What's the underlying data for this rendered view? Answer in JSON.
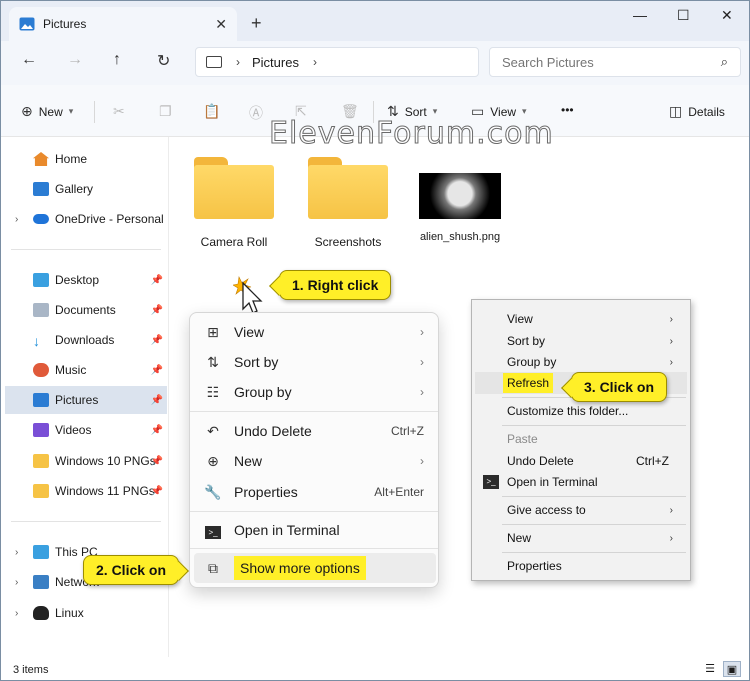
{
  "window": {
    "tab_title": "Pictures",
    "tab_close": "✕",
    "new_tab": "+",
    "minimize": "—",
    "maximize": "☐",
    "close": "✕"
  },
  "address": {
    "crumb": "Pictures",
    "search_placeholder": "Search Pictures"
  },
  "toolbar": {
    "new_label": "New",
    "sort_label": "Sort",
    "view_label": "View",
    "more_label": "•••",
    "details_label": "Details"
  },
  "watermark": "ElevenForum.com",
  "sidebar": {
    "items": [
      {
        "label": "Home"
      },
      {
        "label": "Gallery"
      },
      {
        "label": "OneDrive - Personal"
      },
      {
        "label": "Desktop"
      },
      {
        "label": "Documents"
      },
      {
        "label": "Downloads"
      },
      {
        "label": "Music"
      },
      {
        "label": "Pictures"
      },
      {
        "label": "Videos"
      },
      {
        "label": "Windows 10 PNGs"
      },
      {
        "label": "Windows 11 PNGs"
      },
      {
        "label": "This PC"
      },
      {
        "label": "Network"
      },
      {
        "label": "Linux"
      }
    ]
  },
  "files": [
    {
      "name": "Camera Roll",
      "type": "folder"
    },
    {
      "name": "Screenshots",
      "type": "folder"
    },
    {
      "name": "alien_shush.png",
      "type": "image"
    }
  ],
  "status": {
    "count": "3 items"
  },
  "callouts": {
    "right_click": "1. Right click",
    "click_on_2": "2. Click on",
    "click_on_3": "3. Click on"
  },
  "context_menu": {
    "view": "View",
    "sort_by": "Sort by",
    "group_by": "Group by",
    "undo_delete": "Undo Delete",
    "undo_shortcut": "Ctrl+Z",
    "new": "New",
    "properties": "Properties",
    "properties_shortcut": "Alt+Enter",
    "open_terminal": "Open in Terminal",
    "show_more": "Show more options"
  },
  "classic_menu": {
    "view": "View",
    "sort_by": "Sort by",
    "group_by": "Group by",
    "refresh": "Refresh",
    "customize": "Customize this folder...",
    "paste": "Paste",
    "undo_delete": "Undo Delete",
    "undo_shortcut": "Ctrl+Z",
    "open_terminal": "Open in Terminal",
    "give_access": "Give access to",
    "new": "New",
    "properties": "Properties"
  },
  "colors": {
    "callout": "#ffef28",
    "folder": "#f6c345",
    "selected": "#dbe3ee"
  }
}
